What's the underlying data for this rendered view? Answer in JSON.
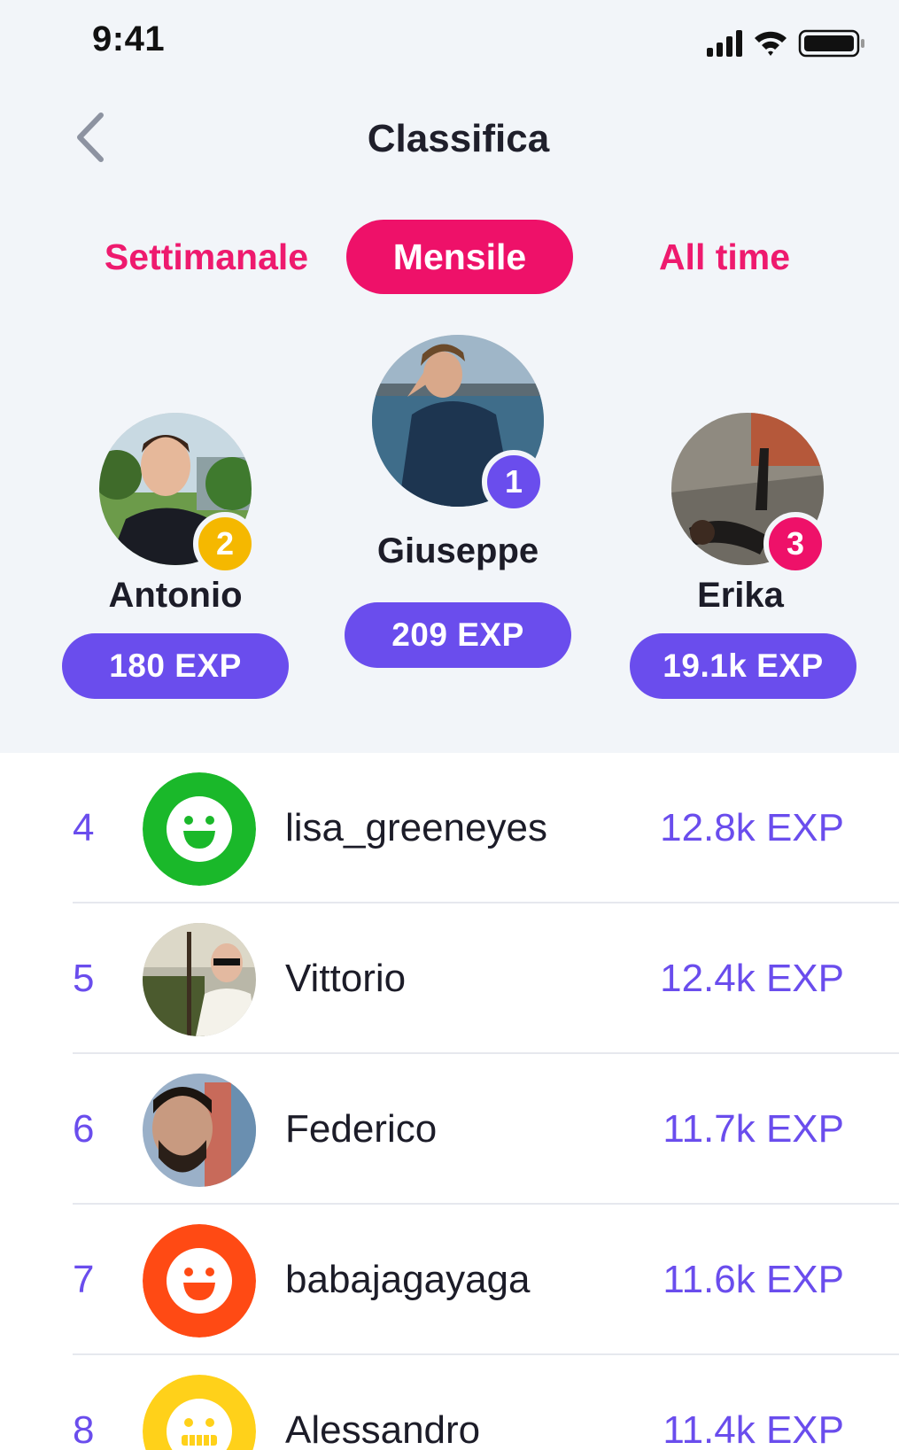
{
  "status_bar": {
    "time": "9:41",
    "icons": [
      "signal-icon",
      "wifi-icon",
      "battery-icon"
    ]
  },
  "header": {
    "title": "Classifica",
    "back_icon": "chevron-left-icon"
  },
  "tabs": [
    {
      "label": "Settimanale",
      "active": false
    },
    {
      "label": "Mensile",
      "active": true
    },
    {
      "label": "All time",
      "active": false
    }
  ],
  "podium": {
    "first": {
      "rank": "1",
      "name": "Giuseppe",
      "exp": "209 EXP"
    },
    "second": {
      "rank": "2",
      "name": "Antonio",
      "exp": "180 EXP"
    },
    "third": {
      "rank": "3",
      "name": "Erika",
      "exp": "19.1k EXP"
    }
  },
  "leaderboard": [
    {
      "rank": "4",
      "name": "lisa_greeneyes",
      "exp": "12.8k EXP",
      "avatar": "smiley-green-icon"
    },
    {
      "rank": "5",
      "name": "Vittorio",
      "exp": "12.4k EXP",
      "avatar": "photo"
    },
    {
      "rank": "6",
      "name": "Federico",
      "exp": "11.7k EXP",
      "avatar": "photo"
    },
    {
      "rank": "7",
      "name": "babajagayaga",
      "exp": "11.6k EXP",
      "avatar": "smiley-orange-icon"
    },
    {
      "rank": "8",
      "name": "Alessandro",
      "exp": "11.4k EXP",
      "avatar": "grimace-yellow-icon"
    }
  ],
  "colors": {
    "accent_pink": "#ee1169",
    "accent_purple": "#6a4ded",
    "badge_gold": "#f5b800",
    "badge_purple": "#6a4ded",
    "badge_pink": "#ee1169",
    "background": "#f2f5f9"
  }
}
